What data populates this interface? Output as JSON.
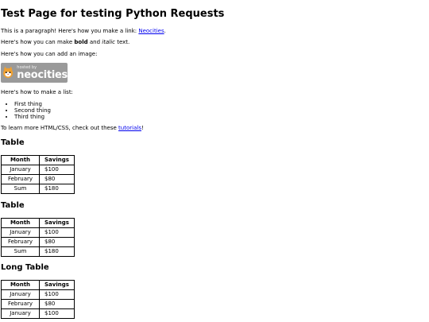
{
  "page": {
    "title": "Test Page for testing Python Requests",
    "para1_prefix": "This is a paragraph! Here's how you make a link: ",
    "para1_link": "Neocities",
    "para1_suffix": ".",
    "para2_a": "Here's how you can make ",
    "para2_bold": "bold",
    "para2_b": " and ",
    "para2_italic": "italic",
    "para2_c": " text.",
    "para3": "Here's how you can add an image:",
    "badge": {
      "small": "hosted by",
      "big": "neocities"
    },
    "list_intro": "Here's how to make a list:",
    "list_items": [
      "First thing",
      "Second thing",
      "Third thing"
    ],
    "learn_prefix": "To learn more HTML/CSS, check out these ",
    "learn_link": "tutorials",
    "learn_suffix": "!"
  },
  "tables": [
    {
      "heading": "Table",
      "headers": [
        "Month",
        "Savings"
      ],
      "rows": [
        [
          "January",
          "$100"
        ],
        [
          "February",
          "$80"
        ],
        [
          "Sum",
          "$180"
        ]
      ]
    },
    {
      "heading": "Table",
      "headers": [
        "Month",
        "Savings"
      ],
      "rows": [
        [
          "January",
          "$100"
        ],
        [
          "February",
          "$80"
        ],
        [
          "Sum",
          "$180"
        ]
      ]
    },
    {
      "heading": "Long Table",
      "headers": [
        "Month",
        "Savings"
      ],
      "rows": [
        [
          "January",
          "$100"
        ],
        [
          "February",
          "$80"
        ],
        [
          "January",
          "$100"
        ]
      ]
    }
  ]
}
